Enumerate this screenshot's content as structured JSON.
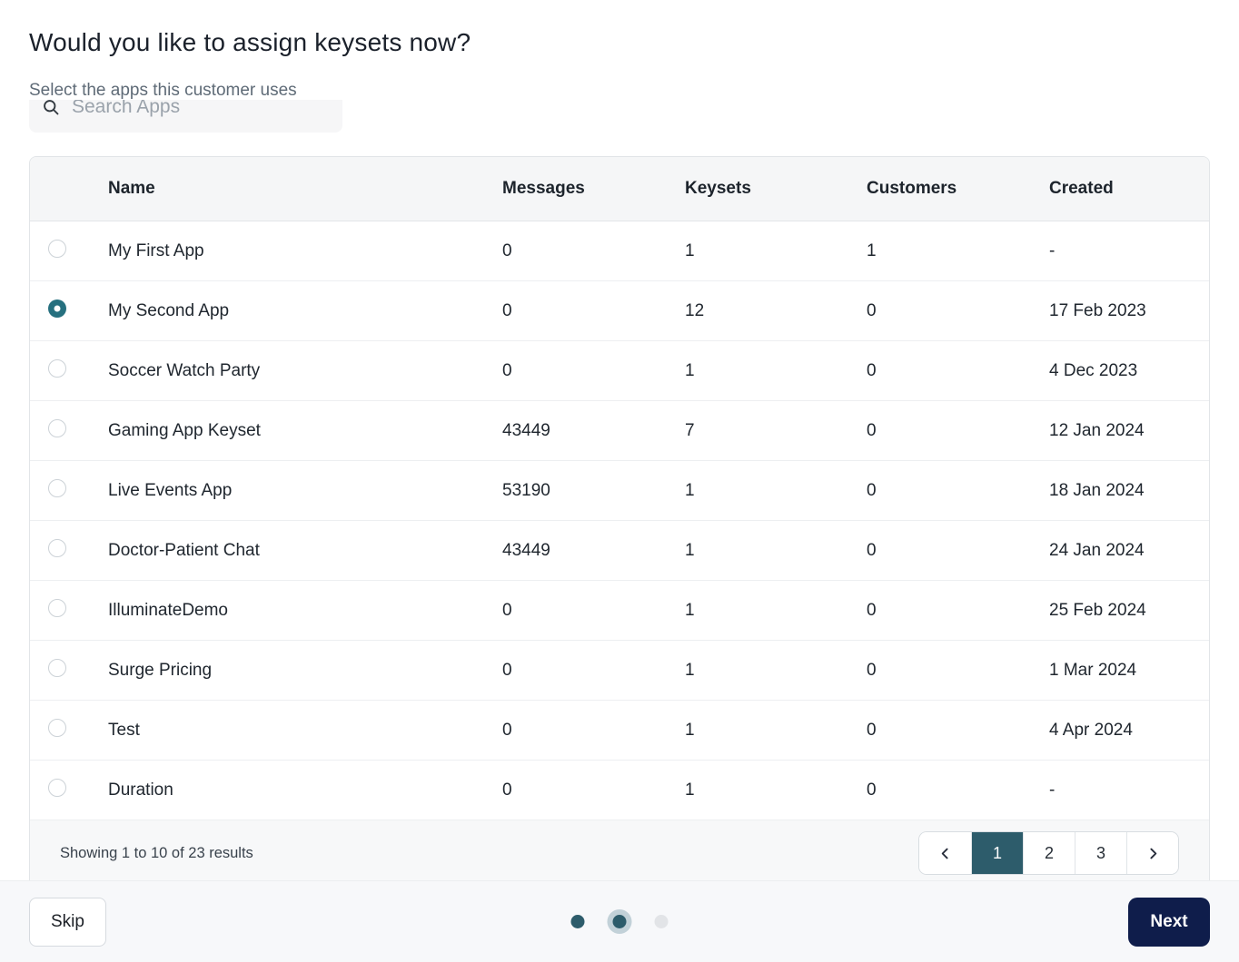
{
  "modal": {
    "title": "Would you like to assign keysets now?",
    "subtitle": "Select the apps this customer uses"
  },
  "search": {
    "placeholder": "Search Apps",
    "icon": "search-icon"
  },
  "table": {
    "columns": [
      "Name",
      "Messages",
      "Keysets",
      "Customers",
      "Created"
    ],
    "rows": [
      {
        "name": "My First App",
        "messages": "0",
        "keysets": "1",
        "customers": "1",
        "created": "-",
        "selected": false
      },
      {
        "name": "My Second App",
        "messages": "0",
        "keysets": "12",
        "customers": "0",
        "created": "17 Feb 2023",
        "selected": true
      },
      {
        "name": "Soccer Watch Party",
        "messages": "0",
        "keysets": "1",
        "customers": "0",
        "created": "4 Dec 2023",
        "selected": false
      },
      {
        "name": "Gaming App Keyset",
        "messages": "43449",
        "keysets": "7",
        "customers": "0",
        "created": "12 Jan 2024",
        "selected": false
      },
      {
        "name": "Live Events App",
        "messages": "53190",
        "keysets": "1",
        "customers": "0",
        "created": "18 Jan 2024",
        "selected": false
      },
      {
        "name": "Doctor-Patient Chat",
        "messages": "43449",
        "keysets": "1",
        "customers": "0",
        "created": "24 Jan 2024",
        "selected": false
      },
      {
        "name": "IlluminateDemo",
        "messages": "0",
        "keysets": "1",
        "customers": "0",
        "created": "25 Feb 2024",
        "selected": false
      },
      {
        "name": "Surge Pricing",
        "messages": "0",
        "keysets": "1",
        "customers": "0",
        "created": "1 Mar 2024",
        "selected": false
      },
      {
        "name": "Test",
        "messages": "0",
        "keysets": "1",
        "customers": "0",
        "created": "4 Apr 2024",
        "selected": false
      },
      {
        "name": "Duration",
        "messages": "0",
        "keysets": "1",
        "customers": "0",
        "created": "-",
        "selected": false
      }
    ]
  },
  "pagination": {
    "summary": "Showing 1 to 10 of 23 results",
    "pages": [
      "1",
      "2",
      "3"
    ],
    "active_page": "1",
    "prev_icon": "chevron-left-icon",
    "next_icon": "chevron-right-icon"
  },
  "footer": {
    "skip_label": "Skip",
    "next_label": "Next",
    "steps": 3,
    "active_step": 2
  },
  "colors": {
    "accent_teal": "#2d5c6b",
    "radio_selected": "#26707f",
    "next_button_navy": "#0f1d4b",
    "table_header_bg": "#f5f6f7",
    "footer_bg": "#f7f8fa"
  }
}
